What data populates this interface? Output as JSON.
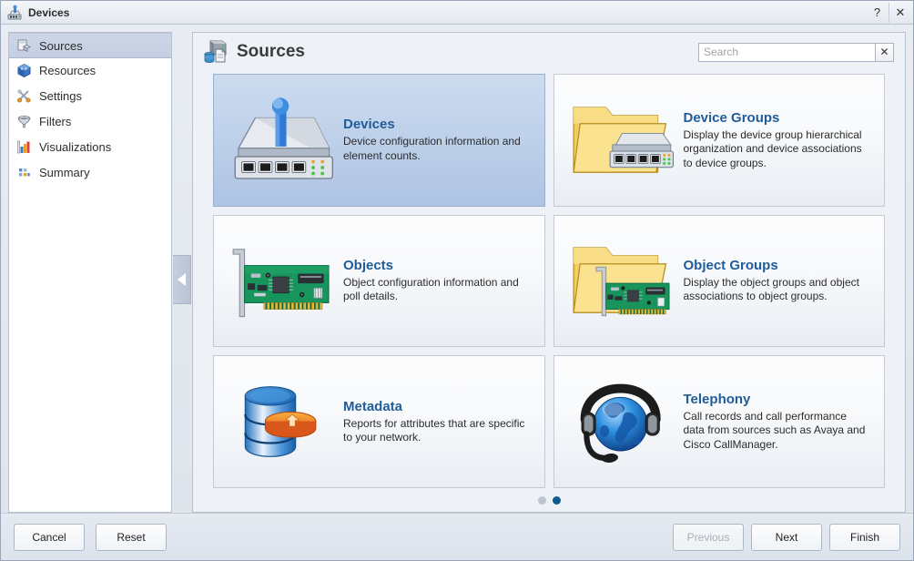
{
  "window": {
    "title": "Devices",
    "icon": "device-router-icon",
    "help_label": "?",
    "close_label": "✕"
  },
  "sidebar": {
    "items": [
      {
        "label": "Sources",
        "icon": "sources-icon",
        "selected": true
      },
      {
        "label": "Resources",
        "icon": "resources-cube-icon",
        "selected": false
      },
      {
        "label": "Settings",
        "icon": "settings-tools-icon",
        "selected": false
      },
      {
        "label": "Filters",
        "icon": "filter-funnel-icon",
        "selected": false
      },
      {
        "label": "Visualizations",
        "icon": "bar-chart-icon",
        "selected": false
      },
      {
        "label": "Summary",
        "icon": "summary-grid-icon",
        "selected": false
      }
    ]
  },
  "collapse_handle": {
    "icon": "chevron-left-icon"
  },
  "content": {
    "header": {
      "icon": "sources-header-icon",
      "title": "Sources"
    },
    "search": {
      "placeholder": "Search",
      "value": "",
      "clear_label": "✕"
    },
    "cards": [
      {
        "title": "Devices",
        "description": "Device configuration information and element counts.",
        "icon": "network-device-icon",
        "selected": true
      },
      {
        "title": "Device Groups",
        "description": "Display the device group hierarchical organization and device associations to device groups.",
        "icon": "folder-device-icon",
        "selected": false
      },
      {
        "title": "Objects",
        "description": "Object configuration information and poll details.",
        "icon": "circuit-card-icon",
        "selected": false
      },
      {
        "title": "Object Groups",
        "description": "Display the object groups and object associations to object groups.",
        "icon": "folder-circuit-icon",
        "selected": false
      },
      {
        "title": "Metadata",
        "description": "Reports for attributes that are specific to your network.",
        "icon": "database-arrow-icon",
        "selected": false
      },
      {
        "title": "Telephony",
        "description": "Call records and call performance data from sources such as Avaya and Cisco CallManager.",
        "icon": "globe-headset-icon",
        "selected": false
      }
    ],
    "pager": {
      "pages": 2,
      "active_index": 1
    }
  },
  "footer": {
    "cancel_label": "Cancel",
    "reset_label": "Reset",
    "previous_label": "Previous",
    "next_label": "Next",
    "finish_label": "Finish",
    "previous_disabled": true
  },
  "colors": {
    "card_title": "#1f5c99",
    "pager_active": "#115a92",
    "selected_card_bg": "#bccfe9",
    "content_bg": "#eef1f5"
  }
}
